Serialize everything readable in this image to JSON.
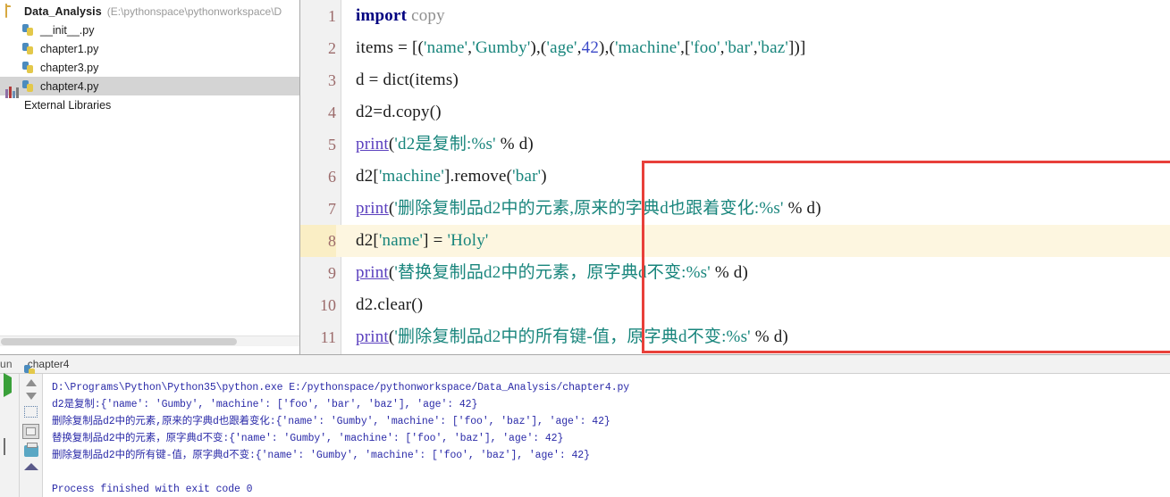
{
  "project": {
    "root": {
      "name": "Data_Analysis",
      "path": "(E:\\pythonspace\\pythonworkspace\\D",
      "icon": "folder-icon"
    },
    "files": [
      {
        "name": "__init__.py",
        "icon": "python-file-icon",
        "selected": false
      },
      {
        "name": "chapter1.py",
        "icon": "python-file-icon",
        "selected": false
      },
      {
        "name": "chapter3.py",
        "icon": "python-file-icon",
        "selected": false
      },
      {
        "name": "chapter4.py",
        "icon": "python-file-icon",
        "selected": true
      }
    ],
    "external_libraries": {
      "label": "External Libraries",
      "icon": "libraries-icon"
    }
  },
  "editor": {
    "highlighted_line": 8,
    "lines": [
      {
        "no": "1",
        "text": "import copy"
      },
      {
        "no": "2",
        "text": "items = [('name','Gumby'),('age',42),('machine',['foo','bar','baz'])]"
      },
      {
        "no": "3",
        "text": "d = dict(items)"
      },
      {
        "no": "4",
        "text": "d2=d.copy()"
      },
      {
        "no": "5",
        "text": "print('d2是复制:%s' % d)"
      },
      {
        "no": "6",
        "text": "d2['machine'].remove('bar')"
      },
      {
        "no": "7",
        "text": "print('删除复制品d2中的元素,原来的字典d也跟着变化:%s' % d)"
      },
      {
        "no": "8",
        "text": "d2['name'] = 'Holy'"
      },
      {
        "no": "9",
        "text": "print('替换复制品d2中的元素，原字典d不变:%s' % d)"
      },
      {
        "no": "10",
        "text": "d2.clear()"
      },
      {
        "no": "11",
        "text": "print('删除复制品d2中的所有键-值，原字典d不变:%s' % d)"
      }
    ],
    "annotation_box_color": "#e8403a"
  },
  "run_window": {
    "tool_label": "un",
    "tab_label": "chapter4",
    "tab_icon": "python-file-icon",
    "left_icons": [
      "run-icon",
      "stop-icon",
      "pause-icon",
      "console-icon",
      "profile-icon"
    ],
    "tool_icons": [
      "arrow-up-icon",
      "arrow-down-icon",
      "soft-wrap-icon",
      "scroll-to-end-icon",
      "print-icon",
      "export-icon"
    ],
    "console_lines": [
      "D:\\Programs\\Python\\Python35\\python.exe E:/pythonspace/pythonworkspace/Data_Analysis/chapter4.py",
      "d2是复制:{'name': 'Gumby', 'machine': ['foo', 'bar', 'baz'], 'age': 42}",
      "删除复制品d2中的元素,原来的字典d也跟着变化:{'name': 'Gumby', 'machine': ['foo', 'baz'], 'age': 42}",
      "替换复制品d2中的元素，原字典d不变:{'name': 'Gumby', 'machine': ['foo', 'baz'], 'age': 42}",
      "删除复制品d2中的所有键-值，原字典d不变:{'name': 'Gumby', 'machine': ['foo', 'baz'], 'age': 42}",
      "",
      "Process finished with exit code 0"
    ]
  }
}
